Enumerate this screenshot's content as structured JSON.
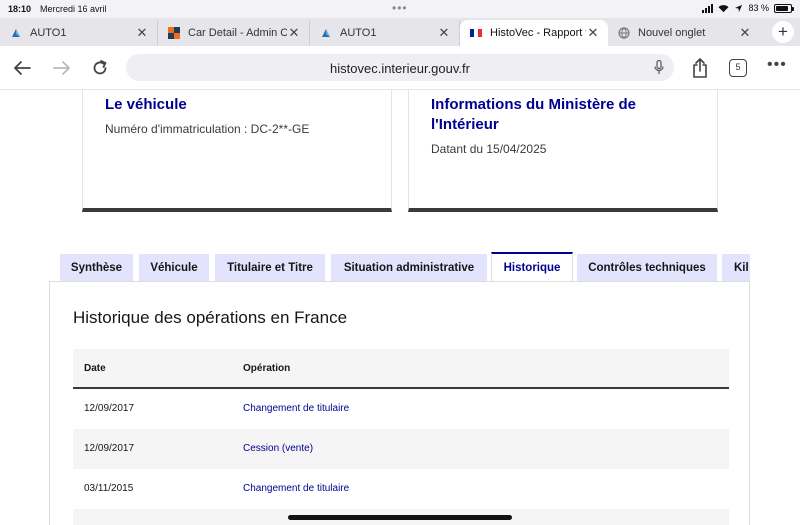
{
  "status_bar": {
    "time": "18:10",
    "date": "Mercredi 16 avril",
    "battery": "83 %",
    "battery_level": 0.83
  },
  "browser": {
    "tabs": [
      {
        "label": "AUTO1",
        "icon": "auto1-icon",
        "active": false
      },
      {
        "label": "Car Detail - Admin C",
        "icon": "admin-favicon",
        "active": false
      },
      {
        "label": "AUTO1",
        "icon": "auto1-icon",
        "active": false
      },
      {
        "label": "HistoVec - Rapport v",
        "icon": "french-flag-icon",
        "active": true
      },
      {
        "label": "Nouvel onglet",
        "icon": "globe-icon",
        "active": false
      }
    ],
    "url": "histovec.interieur.gouv.fr",
    "tab_count": "5"
  },
  "cards": {
    "vehicle": {
      "title": "Le véhicule",
      "text": "Numéro d'immatriculation : DC-2**-GE"
    },
    "ministry": {
      "title": "Informations du Ministère de l'Intérieur",
      "text": "Datant du 15/04/2025"
    }
  },
  "page_tabs": [
    "Synthèse",
    "Véhicule",
    "Titulaire et Titre",
    "Situation administrative",
    "Historique",
    "Contrôles techniques",
    "Kil"
  ],
  "active_page_tab": "Historique",
  "history": {
    "title": "Historique des opérations en France",
    "columns": [
      "Date",
      "Opération"
    ],
    "rows": [
      {
        "date": "12/09/2017",
        "operation": "Changement de titulaire"
      },
      {
        "date": "12/09/2017",
        "operation": "Cession (vente)"
      },
      {
        "date": "03/11/2015",
        "operation": "Changement de titulaire"
      }
    ]
  },
  "colors": {
    "accent": "#000091",
    "tab_bg": "#e3e3fd",
    "row_alt": "#f5f5f5"
  }
}
